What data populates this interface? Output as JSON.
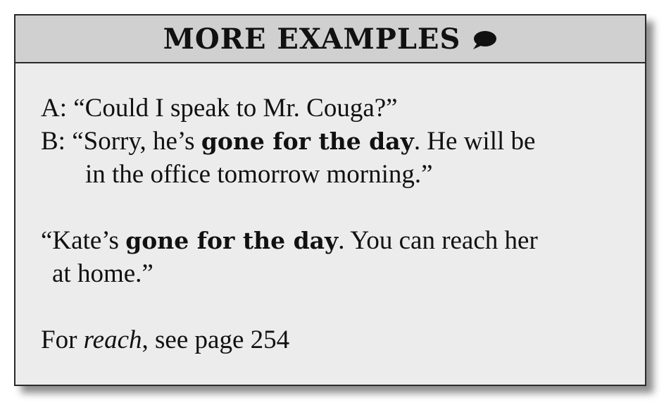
{
  "header": {
    "title": "MORE EXAMPLES",
    "icon": "speech-bubble-icon"
  },
  "dialogue": {
    "line_a": "A: “Could I speak to Mr. Couga?”",
    "line_b_start": "B: “Sorry, he’s ",
    "line_b_bold": "gone for the day",
    "line_b_end": ". He will be",
    "line_b_cont": "in the office tomorrow morning.”"
  },
  "quote": {
    "start": "“Kate’s ",
    "bold": "gone for the day",
    "end": ". You can reach her",
    "cont": "at home.”"
  },
  "reference": {
    "prefix": "For ",
    "italic": "reach",
    "suffix": ", see page 254"
  },
  "colors": {
    "card_background": "#ececec",
    "header_background": "#d0d0d0",
    "border": "#2a2a2a"
  }
}
